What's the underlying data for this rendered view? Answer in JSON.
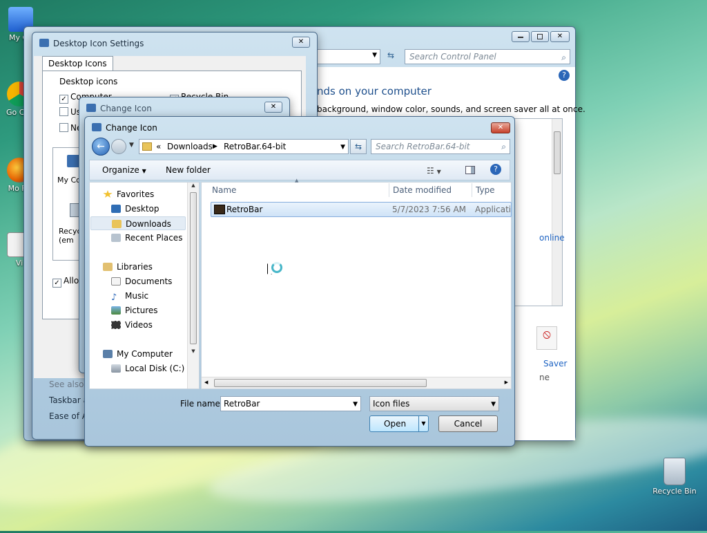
{
  "desktop": {
    "icons": [
      {
        "label": "My Co",
        "id": "my-computer"
      },
      {
        "label": "Go Chr",
        "id": "chrome"
      },
      {
        "label": "Mo Fir",
        "id": "firefox"
      },
      {
        "label": "Vi",
        "id": "vi"
      },
      {
        "label": "Recycle Bin",
        "id": "recycle-bin"
      }
    ]
  },
  "control_panel": {
    "search_placeholder": "Search Control Panel",
    "heading": "nds on your computer",
    "subtext": "background, window color, sounds, and screen saver all at once.",
    "link_online": "online",
    "saver_label": "Saver",
    "saver_sub": "ne"
  },
  "desktop_icon_settings": {
    "title": "Desktop Icon Settings",
    "tab": "Desktop Icons",
    "group_label": "Desktop icons",
    "checks": [
      {
        "label": "Computer",
        "checked": true
      },
      {
        "label": "Recycle Bin",
        "checked": true
      },
      {
        "label": "Us",
        "checked": false
      },
      {
        "label": "Ne",
        "checked": false
      }
    ],
    "preview_icons": [
      "My Co",
      "Recyc (em"
    ],
    "allow_label": "Allow",
    "see_also": "See also",
    "link1": "Taskbar a",
    "link2": "Ease of Ac"
  },
  "change_icon_back": {
    "title": "Change Icon"
  },
  "change_icon": {
    "title": "Change Icon",
    "breadcrumb": [
      "«",
      "Downloads",
      "RetroBar.64-bit"
    ],
    "search_placeholder": "Search RetroBar.64-bit",
    "toolbar": {
      "organize": "Organize",
      "new_folder": "New folder"
    },
    "nav": {
      "favorites": "Favorites",
      "desktop": "Desktop",
      "downloads": "Downloads",
      "recent": "Recent Places",
      "libraries": "Libraries",
      "documents": "Documents",
      "music": "Music",
      "pictures": "Pictures",
      "videos": "Videos",
      "my_computer": "My Computer",
      "local_disk": "Local Disk (C:)"
    },
    "columns": {
      "name": "Name",
      "date": "Date modified",
      "type": "Type"
    },
    "files": [
      {
        "name": "RetroBar",
        "date": "5/7/2023 7:56 AM",
        "type": "Applicatio"
      }
    ],
    "filename_label": "File name:",
    "filename_value": "RetroBar",
    "filter_value": "Icon files",
    "open_label": "Open",
    "cancel_label": "Cancel"
  }
}
